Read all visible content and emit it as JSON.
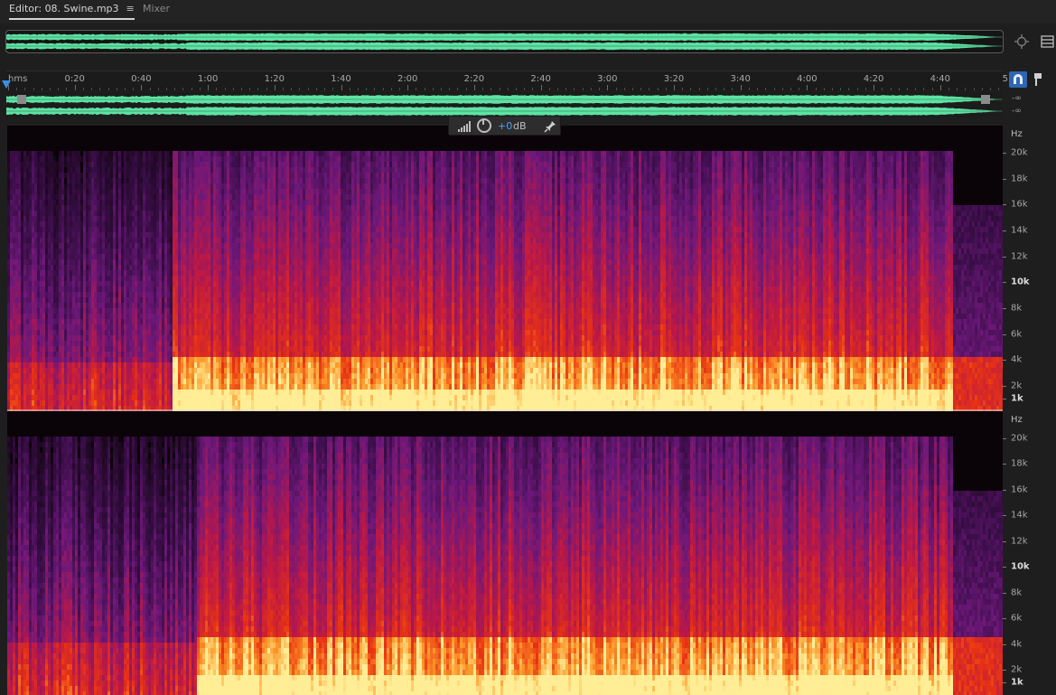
{
  "tabs": {
    "editor_label": "Editor: 08. Swine.mp3",
    "editor_menu_icon": "≡",
    "mixer_label": "Mixer"
  },
  "colors": {
    "waveform": "#5ee3a4",
    "playhead": "#3d8ee8",
    "active_button": "#2f66b3",
    "hud_value": "#4ca0ff"
  },
  "icons": {
    "overview_zoom": "crosshair-zoom-icon",
    "overview_menu": "panel-menu-icon",
    "snap": "magnet-icon",
    "marker": "marker-pin-icon",
    "hud_meter": "signal-bars-icon",
    "hud_knob": "gain-knob-icon",
    "hud_pin": "pin-icon"
  },
  "ruler": {
    "unit": "hms",
    "labels": [
      "0:20",
      "0:40",
      "1:00",
      "1:20",
      "1:40",
      "2:00",
      "2:20",
      "2:40",
      "3:00",
      "3:20",
      "3:40",
      "4:00",
      "4:20",
      "4:40",
      "5:"
    ]
  },
  "meters": {
    "top": "-∞",
    "bottom": "-∞"
  },
  "hud": {
    "value": "+0",
    "unit": "dB"
  },
  "frequency_axis": {
    "unit": "Hz",
    "labels": [
      "20k",
      "18k",
      "16k",
      "14k",
      "12k",
      "10k",
      "8k",
      "6k",
      "4k",
      "2k",
      "1k"
    ],
    "emphasized": [
      "10k",
      "1k"
    ]
  }
}
